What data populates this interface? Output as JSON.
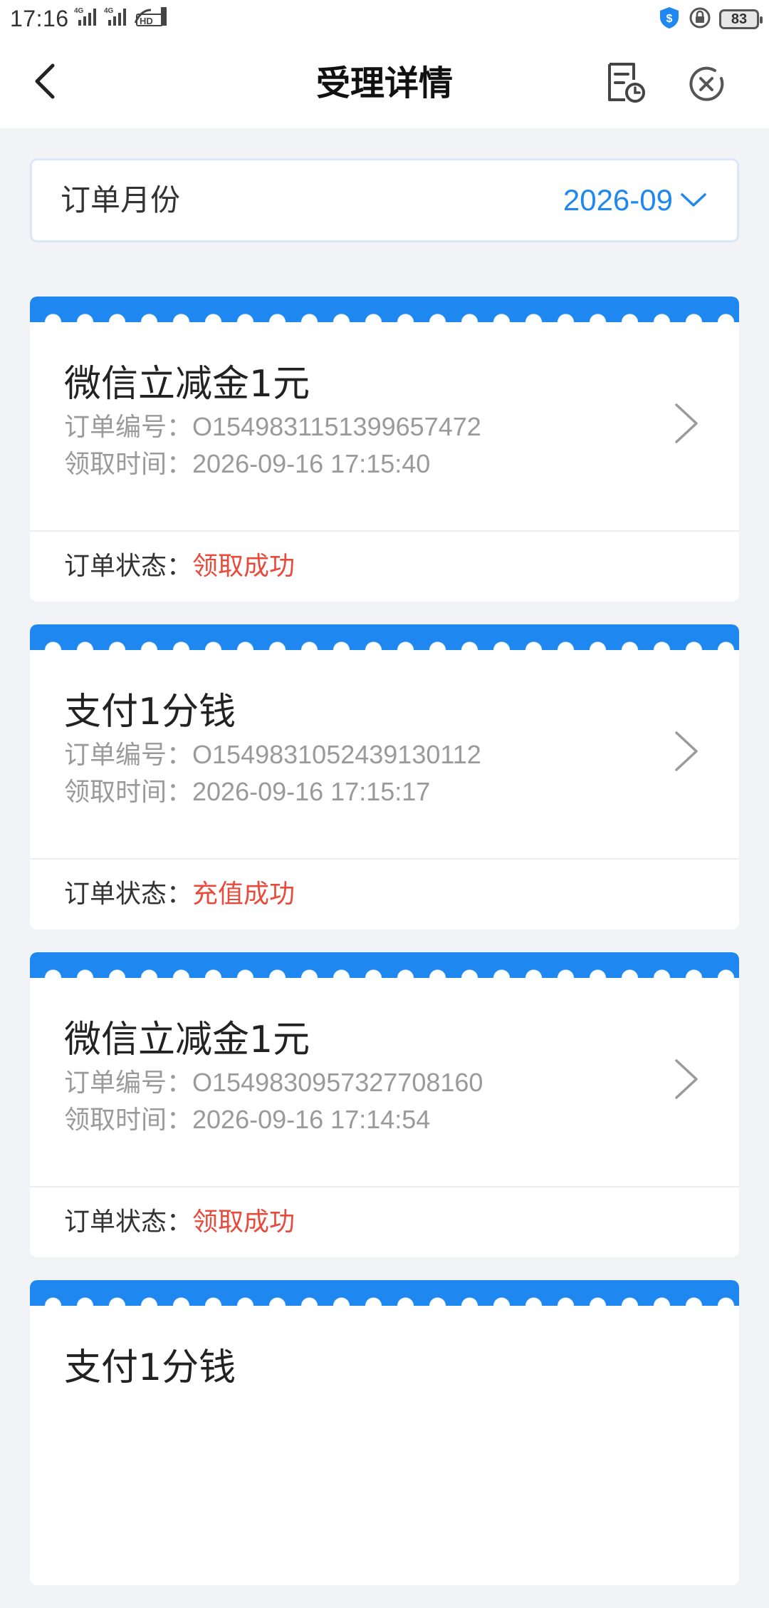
{
  "status_bar": {
    "time": "17:16",
    "battery": "83",
    "signal_icons": [
      "4g-signal-icon",
      "4g-signal-icon",
      "hd2-icon"
    ],
    "right_icons": [
      "shield-dollar-icon",
      "rotation-lock-icon",
      "battery-icon"
    ]
  },
  "nav": {
    "title": "受理详情",
    "back_icon": "back-arrow-icon",
    "history_icon": "order-history-icon",
    "close_icon": "close-circle-icon"
  },
  "month_selector": {
    "label": "订单月份",
    "value": "2026-09",
    "icon": "chevron-down-icon"
  },
  "colors": {
    "accent": "#1f88f0",
    "status": "#e84a3b",
    "background": "#f1f3f7"
  },
  "orders": [
    {
      "title": "微信立减金1元",
      "order_no_label": "订单编号：",
      "order_no": "O1549831151399657472",
      "time_label": "领取时间：",
      "time": "2026-09-16 17:15:40",
      "status_label": "订单状态：",
      "status": "领取成功"
    },
    {
      "title": "支付1分钱",
      "order_no_label": "订单编号：",
      "order_no": "O1549831052439130112",
      "time_label": "领取时间：",
      "time": "2026-09-16 17:15:17",
      "status_label": "订单状态：",
      "status": "充值成功"
    },
    {
      "title": "微信立减金1元",
      "order_no_label": "订单编号：",
      "order_no": "O1549830957327708160",
      "time_label": "领取时间：",
      "time": "2026-09-16 17:14:54",
      "status_label": "订单状态：",
      "status": "领取成功"
    },
    {
      "title": "支付1分钱"
    }
  ]
}
